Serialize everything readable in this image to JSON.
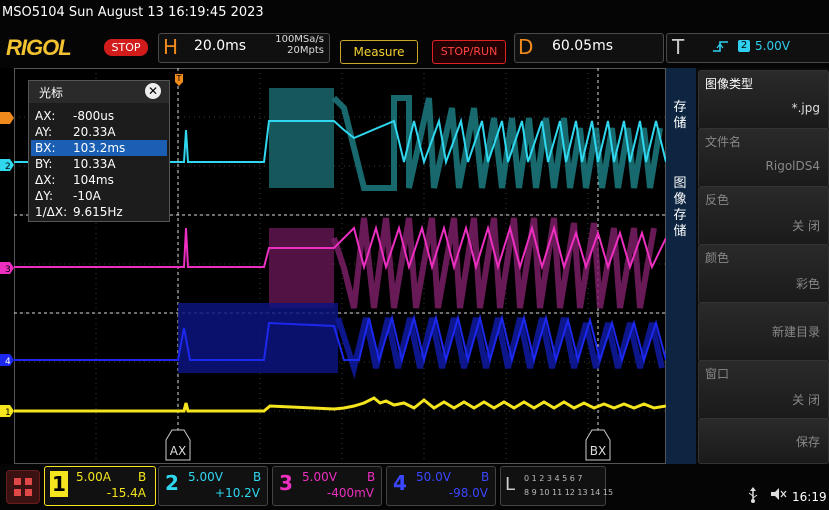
{
  "header": {
    "model_datetime": "MSO5104  Sun August 13 16:19:45 2023",
    "logo": "RIGOL",
    "run_state": "STOP",
    "horizontal": {
      "letter": "H",
      "timebase": "20.0ms",
      "sample_rate": "100MSa/s",
      "memory_depth": "20Mpts"
    },
    "measure_label": "Measure",
    "stop_run_label": "STOP/RUN",
    "delay": {
      "letter": "D",
      "value": "60.05ms"
    },
    "trigger": {
      "letter": "T",
      "edge_icon": "rising-edge-icon",
      "source": "2",
      "level": "5.00V"
    }
  },
  "cursor_panel": {
    "title": "光标",
    "close_icon": "close-icon",
    "rows": [
      {
        "key": "AX:",
        "value": "-800us",
        "selected": false
      },
      {
        "key": "AY:",
        "value": "20.33A",
        "selected": false
      },
      {
        "key": "BX:",
        "value": "103.2ms",
        "selected": true
      },
      {
        "key": "BY:",
        "value": "10.33A",
        "selected": false
      },
      {
        "key": "ΔX:",
        "value": "104ms",
        "selected": false
      },
      {
        "key": "ΔY:",
        "value": "-10A",
        "selected": false
      },
      {
        "key": "1/ΔX:",
        "value": "9.615Hz",
        "selected": false
      }
    ]
  },
  "markers": {
    "ax": "AX",
    "bx": "BX",
    "t_marker": "T",
    "ch1": "1",
    "ch2": "2",
    "ch3": "3",
    "ch4": "4"
  },
  "side_tabs": {
    "tab1": "存储",
    "tab2": "图像存储"
  },
  "side_menu": [
    {
      "title": "图像类型",
      "value": "*.jpg",
      "dim": false
    },
    {
      "title": "文件名",
      "value": "RigolDS4",
      "dim": true
    },
    {
      "title": "反色",
      "value": "关  闭",
      "dim": true
    },
    {
      "title": "颜色",
      "value": "彩色",
      "dim": true
    },
    {
      "title": "",
      "value": "新建目录",
      "dim": true
    },
    {
      "title": "窗口",
      "value": "关  闭",
      "dim": true
    },
    {
      "title": "",
      "value": "保存",
      "dim": true
    }
  ],
  "channels": [
    {
      "num": "1",
      "scale": "5.00A",
      "bw": "B",
      "offset": "-15.4A",
      "color": "#f5e51e"
    },
    {
      "num": "2",
      "scale": "5.00V",
      "bw": "B",
      "offset": "+10.2V",
      "color": "#2fd8ef"
    },
    {
      "num": "3",
      "scale": "5.00V",
      "bw": "B",
      "offset": "-400mV",
      "color": "#ec2fc0"
    },
    {
      "num": "4",
      "scale": "50.0V",
      "bw": "B",
      "offset": "-98.0V",
      "color": "#1c28ee"
    }
  ],
  "logic": {
    "letter": "L",
    "row1": "0 1 2 3 4 5 6 7",
    "row2": "8 9 10 11 12 13 14 15"
  },
  "status": {
    "clock": "16:19",
    "usb_icon": "usb-icon",
    "speaker_icon": "speaker-icon"
  }
}
